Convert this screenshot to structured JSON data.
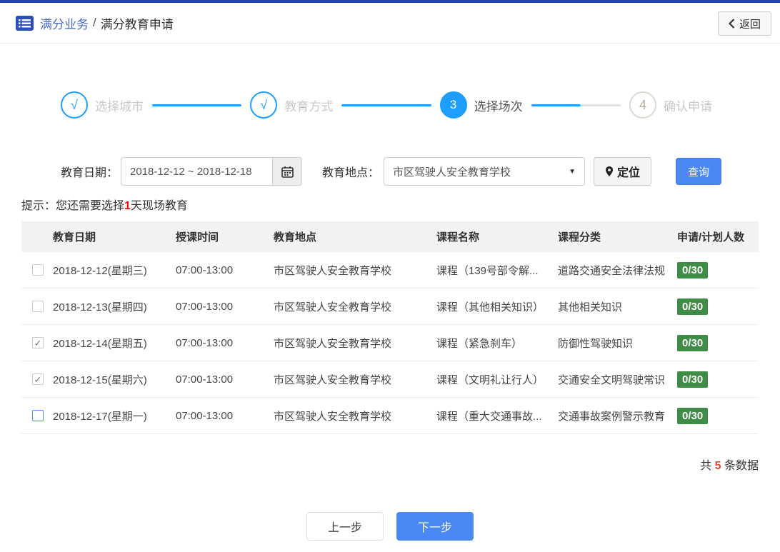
{
  "header": {
    "breadcrumb_primary": "满分业务",
    "breadcrumb_separator": "/",
    "breadcrumb_secondary": "满分教育申请",
    "back_label": "返回"
  },
  "steps": [
    {
      "mark": "√",
      "label": "选择城市",
      "state": "done"
    },
    {
      "mark": "√",
      "label": "教育方式",
      "state": "done"
    },
    {
      "mark": "3",
      "label": "选择场次",
      "state": "active"
    },
    {
      "mark": "4",
      "label": "确认申请",
      "state": "pending"
    }
  ],
  "filters": {
    "date_label": "教育日期：",
    "date_value": "2018-12-12 ~ 2018-12-18",
    "location_label": "教育地点：",
    "location_value": "市区驾驶人安全教育学校",
    "locate_button": "定位",
    "search_button": "查询"
  },
  "hint": {
    "prefix": "提示：您还需要选择",
    "highlight": "1",
    "suffix": "天现场教育"
  },
  "table": {
    "columns": [
      "教育日期",
      "授课时间",
      "教育地点",
      "课程名称",
      "课程分类",
      "申请/计划人数"
    ],
    "rows": [
      {
        "checkbox": "unchecked",
        "date": "2018-12-12(星期三)",
        "time": "07:00-13:00",
        "location": "市区驾驶人安全教育学校",
        "course": "课程（139号部令解...",
        "category": "道路交通安全法律法规",
        "count": "0/30"
      },
      {
        "checkbox": "unchecked",
        "date": "2018-12-13(星期四)",
        "time": "07:00-13:00",
        "location": "市区驾驶人安全教育学校",
        "course": "课程（其他相关知识）",
        "category": "其他相关知识",
        "count": "0/30"
      },
      {
        "checkbox": "checked",
        "date": "2018-12-14(星期五)",
        "time": "07:00-13:00",
        "location": "市区驾驶人安全教育学校",
        "course": "课程（紧急刹车）",
        "category": "防御性驾驶知识",
        "count": "0/30"
      },
      {
        "checkbox": "checked",
        "date": "2018-12-15(星期六)",
        "time": "07:00-13:00",
        "location": "市区驾驶人安全教育学校",
        "course": "课程（文明礼让行人）",
        "category": "交通安全文明驾驶常识",
        "count": "0/30"
      },
      {
        "checkbox": "unchecked-focus",
        "date": "2018-12-17(星期一)",
        "time": "07:00-13:00",
        "location": "市区驾驶人安全教育学校",
        "course": "课程（重大交通事故...",
        "category": "交通事故案例警示教育",
        "count": "0/30"
      }
    ]
  },
  "summary": {
    "prefix": "共 ",
    "count": "5",
    "suffix": " 条数据"
  },
  "footer": {
    "prev_label": "上一步",
    "next_label": "下一步"
  },
  "icons": {
    "chevron_down": "▼",
    "checkbox_check": "✓"
  },
  "colors": {
    "topbar_blue": "#2444b0",
    "step_blue": "#1e9fff",
    "accent_blue": "#4a89f3",
    "badge_green": "#3f8c46",
    "alert_red": "#ff0000",
    "count_red": "#e8432e"
  }
}
